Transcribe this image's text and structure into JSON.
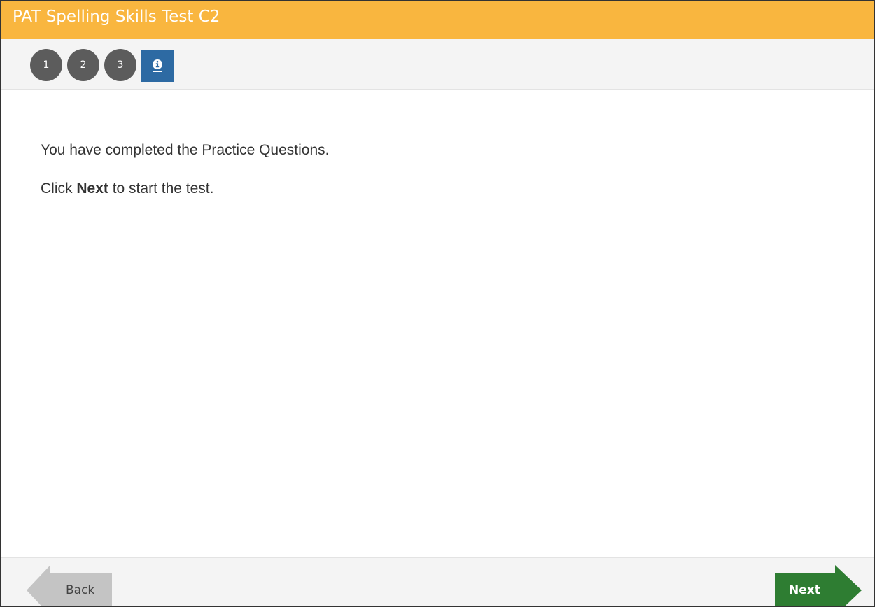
{
  "header": {
    "title": "PAT Spelling Skills Test C2",
    "background_color": "#f9b63f"
  },
  "question_nav": {
    "items": [
      {
        "label": "1"
      },
      {
        "label": "2"
      },
      {
        "label": "3"
      }
    ],
    "info_tab": {
      "icon": "info-icon",
      "active": true,
      "color": "#2d6aa3"
    }
  },
  "content": {
    "line1": "You have completed the Practice Questions.",
    "line2_prefix": "Click ",
    "line2_bold": "Next",
    "line2_suffix": " to start the test."
  },
  "footer": {
    "back_label": "Back",
    "back_color": "#c4c4c4",
    "next_label": "Next",
    "next_color": "#2e7d32"
  }
}
